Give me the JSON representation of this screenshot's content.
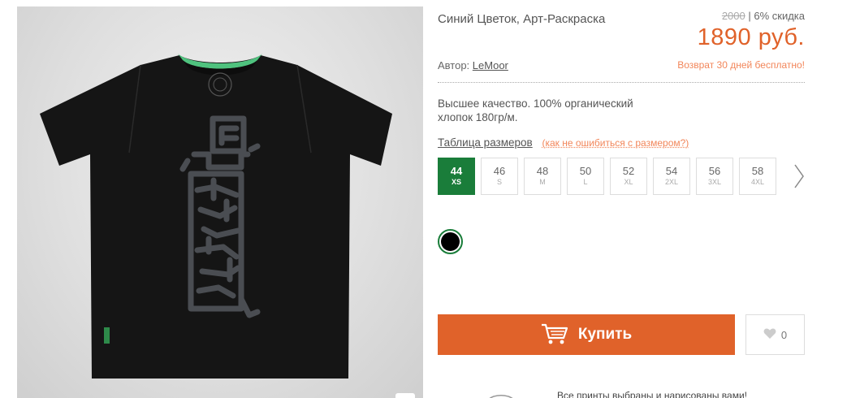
{
  "product": {
    "title": "Синий Цветок, Арт-Раскраска",
    "old_price": "2000",
    "discount": " | 6% скидка",
    "price": "1890 руб.",
    "author_label": "Автор: ",
    "author_name": "LeMoor",
    "return_note": "Возврат 30 дней бесплатно!",
    "description": "Высшее качество. 100% органический хлопок 180гр/м."
  },
  "sizes": {
    "table_link": "Таблица размеров",
    "hint": "(как не ошибиться с размером?)",
    "items": [
      {
        "num": "44",
        "label": "XS"
      },
      {
        "num": "46",
        "label": "S"
      },
      {
        "num": "48",
        "label": "M"
      },
      {
        "num": "50",
        "label": "L"
      },
      {
        "num": "52",
        "label": "XL"
      },
      {
        "num": "54",
        "label": "2XL"
      },
      {
        "num": "56",
        "label": "3XL"
      },
      {
        "num": "58",
        "label": "4XL"
      }
    ]
  },
  "actions": {
    "buy_label": "Купить",
    "like_count": "0"
  },
  "promo": {
    "text": "Все принты выбраны и нарисованы вами!"
  },
  "colors": {
    "accent": "#e0622a",
    "selected": "#1a7d3a",
    "swatch_black": "#000000"
  },
  "icons": {
    "cart": "cart-icon",
    "heart": "heart-icon",
    "next": "chevron-right-icon"
  }
}
